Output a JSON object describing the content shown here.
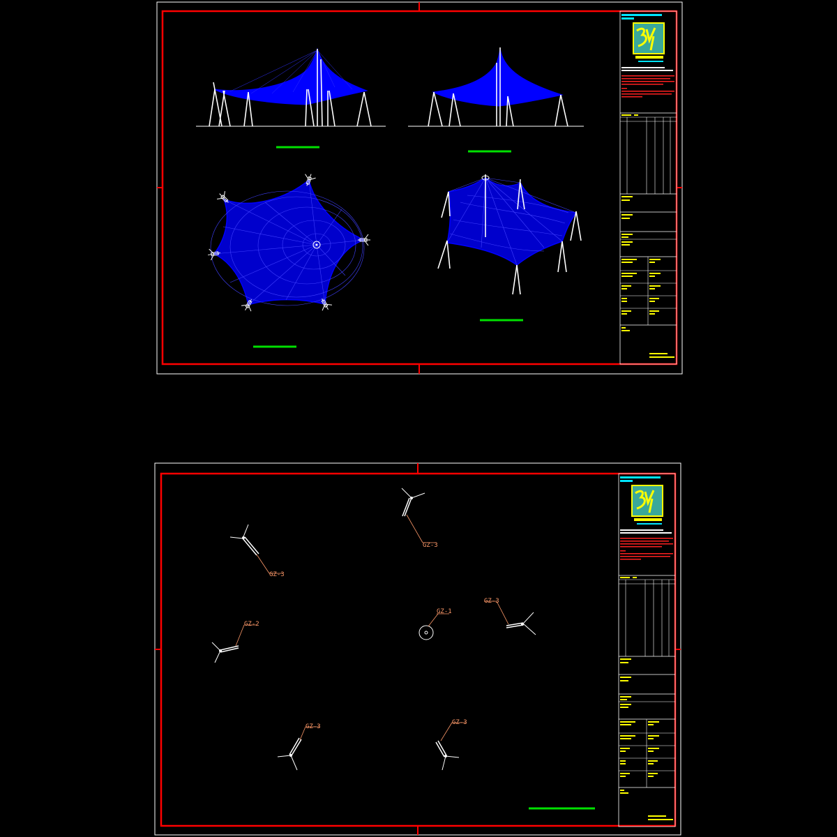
{
  "colors": {
    "background": "#000000",
    "outer_frame": "#ffffff",
    "inner_frame": "#ff0000",
    "membrane": "#0000ff",
    "mast": "#ffffff",
    "scale_bar": "#00e000",
    "logo_bg": "#3aa89a",
    "logo_mark": "#ffff00",
    "label": "#ff9a6a",
    "title_cyan": "#00e5ff",
    "title_red": "#ff2020",
    "title_yellow": "#ffff00"
  },
  "sheet2": {
    "labels": {
      "gz1": "GZ-1",
      "gz2": "GZ-2",
      "gz3_a": "GZ-3",
      "gz3_b": "GZ-3",
      "gz3_c": "GZ-3",
      "gz3_d": "GZ-3",
      "gz3_e": "GZ-3"
    }
  }
}
